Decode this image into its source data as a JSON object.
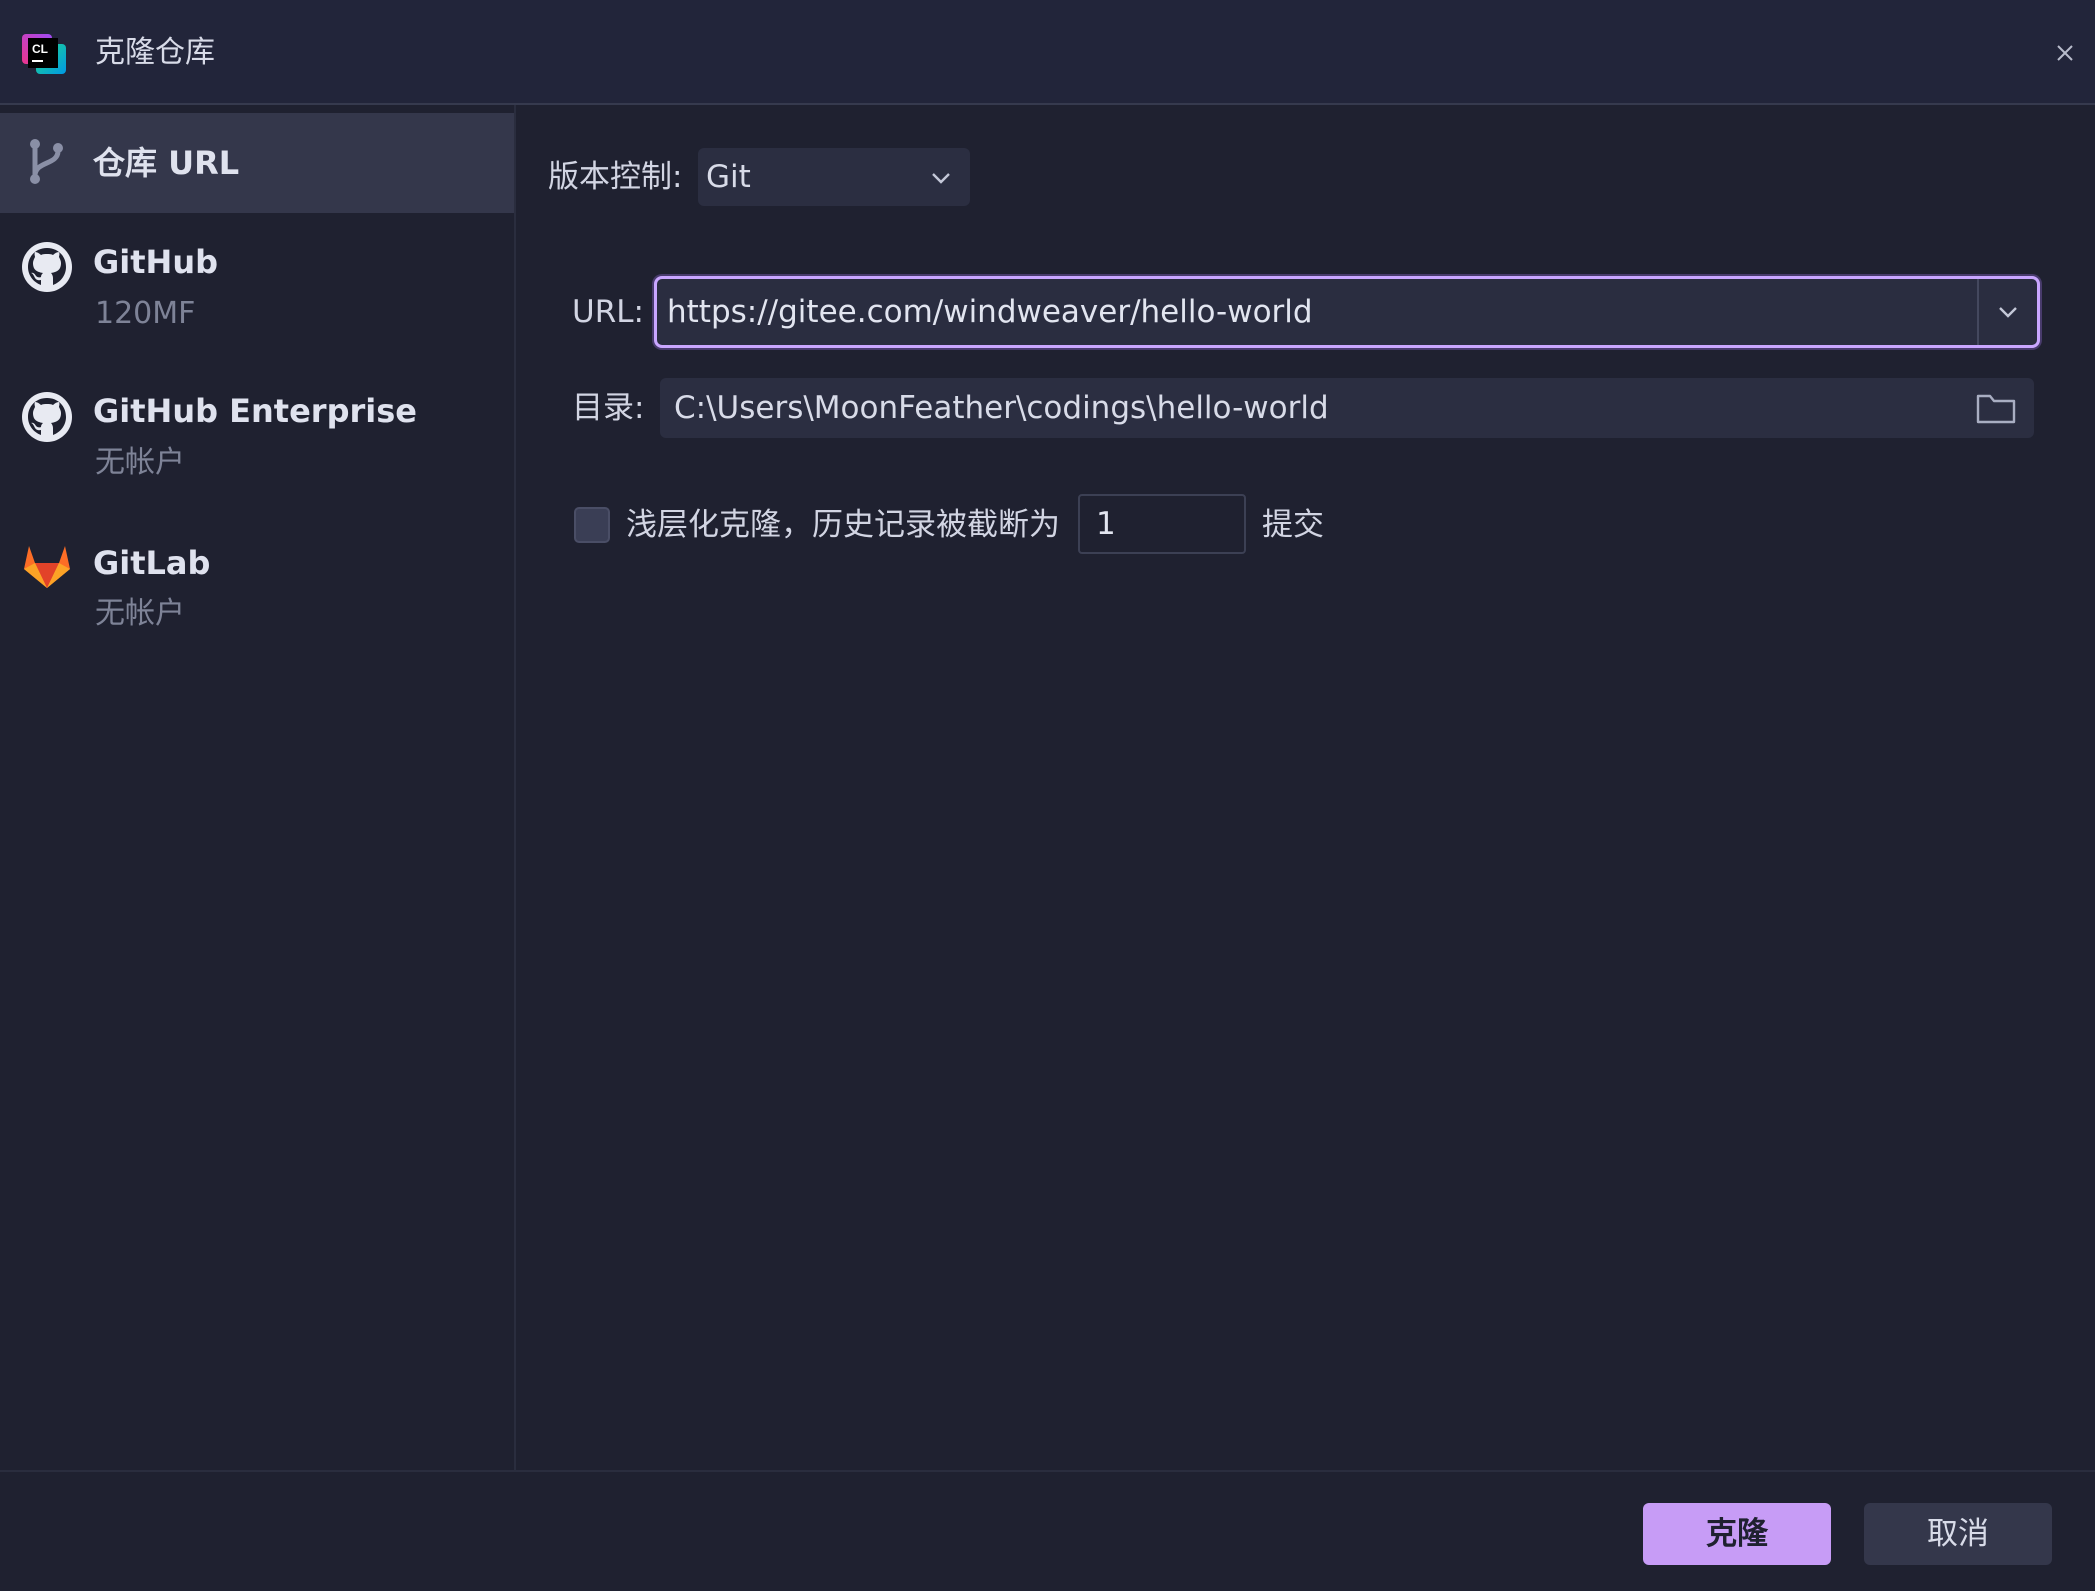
{
  "window": {
    "title": "克隆仓库",
    "close_icon": "close-icon",
    "accent_color": "#2fb5b0"
  },
  "sidebar": {
    "items": [
      {
        "title": "仓库 URL",
        "subtitle": "",
        "icon": "vcs-branch-icon",
        "selected": true
      },
      {
        "title": "GitHub",
        "subtitle": "120MF",
        "icon": "github-icon",
        "selected": false
      },
      {
        "title": "GitHub Enterprise",
        "subtitle": "无帐户",
        "icon": "github-icon",
        "selected": false
      },
      {
        "title": "GitLab",
        "subtitle": "无帐户",
        "icon": "gitlab-icon",
        "selected": false
      }
    ]
  },
  "form": {
    "vcs_label": "版本控制:",
    "vcs_value": "Git",
    "url_label": "URL:",
    "url_value": "https://gitee.com/windweaver/hello-world",
    "dir_label": "目录:",
    "dir_value": "C:\\Users\\MoonFeather\\codings\\hello-world",
    "shallow_checked": false,
    "shallow_label": "浅层化克隆，历史记录被截断为",
    "shallow_depth": "1",
    "shallow_suffix": "提交"
  },
  "footer": {
    "clone_label": "克隆",
    "cancel_label": "取消",
    "primary_color": "#c79cf6"
  }
}
